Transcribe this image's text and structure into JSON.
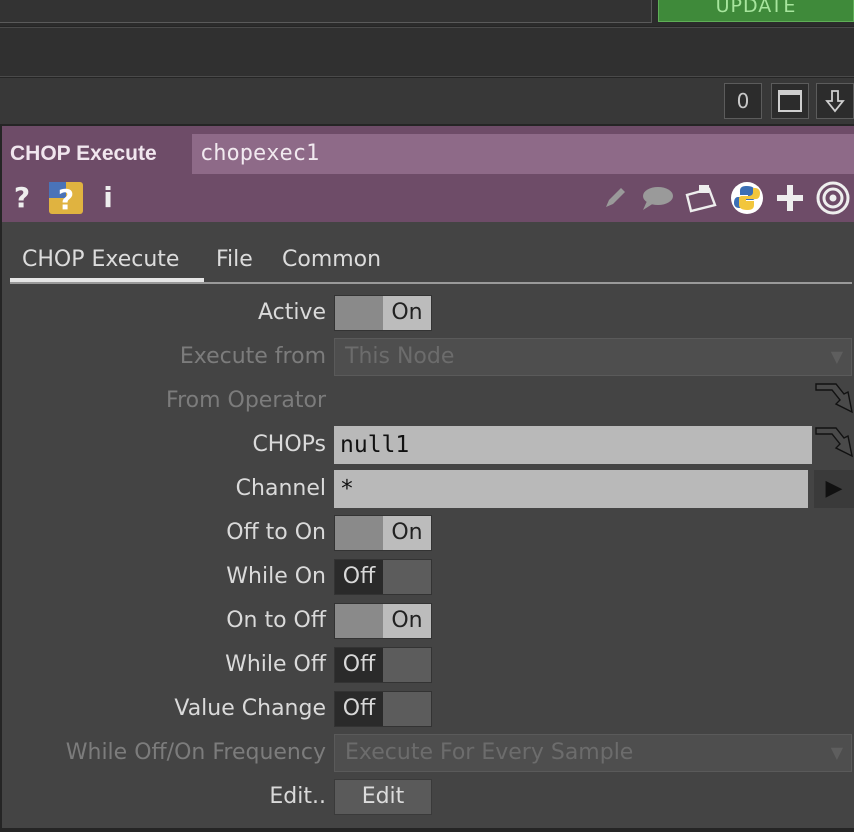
{
  "topbar": {
    "update_label": "UPDATE"
  },
  "strip": {
    "number": "0",
    "maximize_icon": "maximize-icon",
    "down_icon": "down-arrow-icon"
  },
  "header": {
    "op_type": "CHOP Execute",
    "op_name": "chopexec1",
    "icons": [
      "help-icon",
      "python-help-icon",
      "info-icon",
      "pencil-icon",
      "comment-icon",
      "clipboard-icon",
      "python-icon",
      "plus-icon",
      "target-icon"
    ],
    "help_glyph": "?",
    "info_glyph": "i"
  },
  "tabs": [
    {
      "label": "CHOP Execute",
      "active": true
    },
    {
      "label": "File",
      "active": false
    },
    {
      "label": "Common",
      "active": false
    }
  ],
  "params": {
    "active": {
      "label": "Active",
      "value": "On"
    },
    "execute_from": {
      "label": "Execute from",
      "value": "This Node"
    },
    "from_operator": {
      "label": "From Operator"
    },
    "chops": {
      "label": "CHOPs",
      "value": "null1"
    },
    "channel": {
      "label": "Channel",
      "value": "*"
    },
    "off_to_on": {
      "label": "Off to On",
      "value": "On"
    },
    "while_on": {
      "label": "While On",
      "value": "Off"
    },
    "on_to_off": {
      "label": "On to Off",
      "value": "On"
    },
    "while_off": {
      "label": "While Off",
      "value": "Off"
    },
    "value_change": {
      "label": "Value Change",
      "value": "Off"
    },
    "frequency": {
      "label": "While Off/On Frequency",
      "value": "Execute For Every Sample"
    },
    "edit": {
      "label": "Edit..",
      "button": "Edit"
    }
  },
  "colors": {
    "header": "#6e4c68",
    "update": "#3f8a3a",
    "panel": "#444444"
  }
}
